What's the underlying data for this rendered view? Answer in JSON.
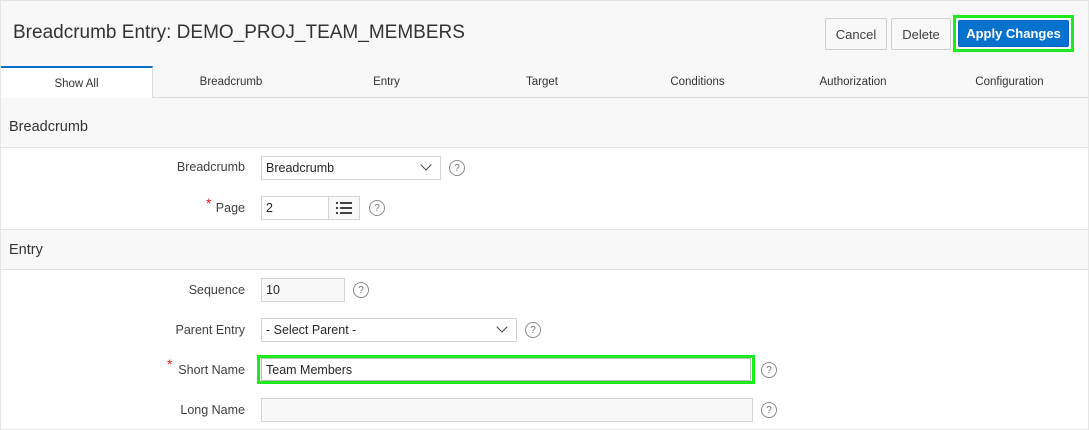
{
  "header": {
    "title": "Breadcrumb Entry: DEMO_PROJ_TEAM_MEMBERS",
    "cancel_label": "Cancel",
    "delete_label": "Delete",
    "apply_label": "Apply Changes"
  },
  "tabs": [
    {
      "label": "Show All"
    },
    {
      "label": "Breadcrumb"
    },
    {
      "label": "Entry"
    },
    {
      "label": "Target"
    },
    {
      "label": "Conditions"
    },
    {
      "label": "Authorization"
    },
    {
      "label": "Configuration"
    }
  ],
  "breadcrumb_section": {
    "heading": "Breadcrumb",
    "breadcrumb_label": "Breadcrumb",
    "breadcrumb_value": "Breadcrumb",
    "page_label": "Page",
    "page_value": "2"
  },
  "entry_section": {
    "heading": "Entry",
    "sequence_label": "Sequence",
    "sequence_value": "10",
    "parent_label": "Parent Entry",
    "parent_value": "- Select Parent -",
    "short_name_label": "Short Name",
    "short_name_value": "Team Members",
    "long_name_label": "Long Name",
    "long_name_value": ""
  },
  "required_marker": "*",
  "help_glyph": "?",
  "colors": {
    "accent": "#0572ce",
    "highlight": "#1ee81e",
    "required": "#e51b1b"
  },
  "icons": {
    "help": "help-icon",
    "list": "list-icon",
    "dropdown": "chevron-down-icon"
  }
}
